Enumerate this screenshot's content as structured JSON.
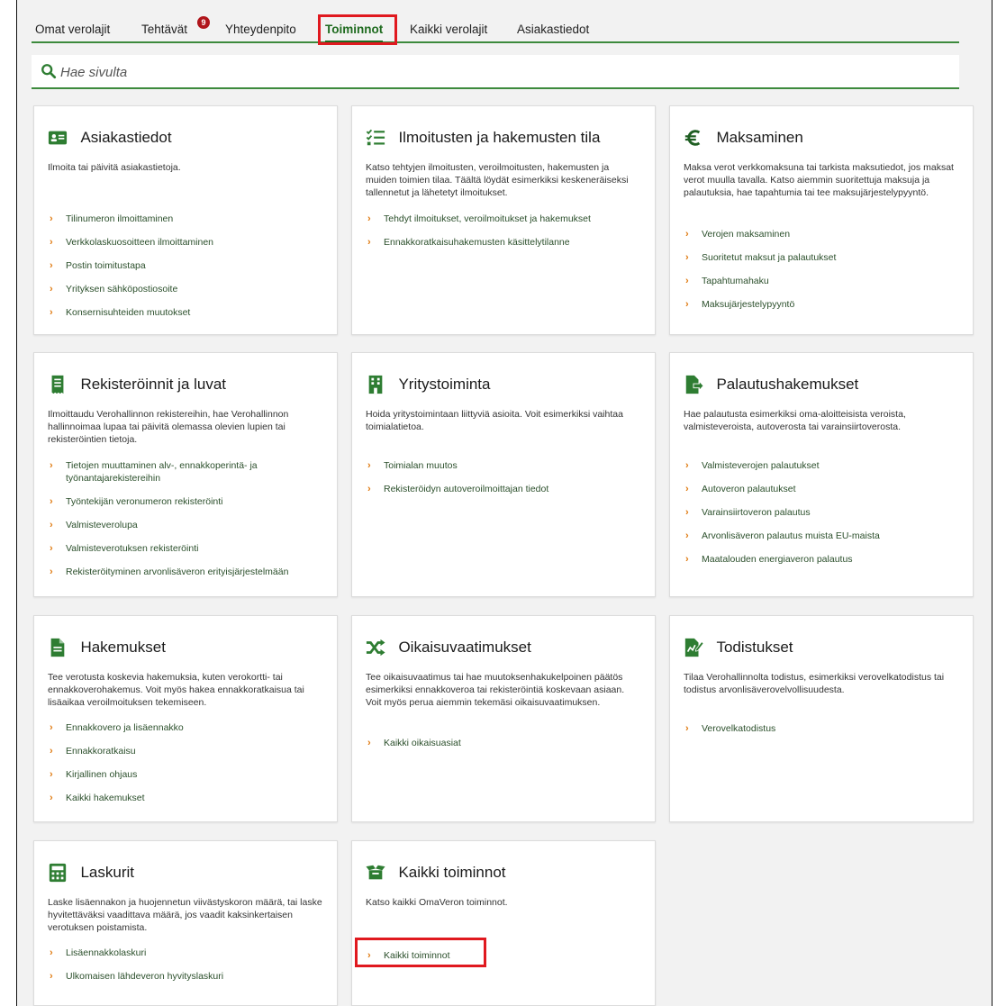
{
  "tabs": [
    {
      "label": "Omat verolajit"
    },
    {
      "label": "Tehtävät",
      "badge": "9"
    },
    {
      "label": "Yhteydenpito"
    },
    {
      "label": "Toiminnot",
      "active": true
    },
    {
      "label": "Kaikki verolajit"
    },
    {
      "label": "Asiakastiedot"
    }
  ],
  "search": {
    "placeholder": "Hae sivulta"
  },
  "colors": {
    "brand_green": "#2e7d32",
    "chevron": "#e07a10",
    "highlight": "#e0191f",
    "badge": "#b0151b"
  },
  "cards": [
    {
      "icon": "id-card-icon",
      "title": "Asiakastiedot",
      "description": "Ilmoita tai päivitä asiakastietoja.",
      "links": [
        "Tilinumeron ilmoittaminen",
        "Verkkolaskuosoitteen ilmoittaminen",
        "Postin toimitustapa",
        "Yrityksen sähköpostiosoite",
        "Konsernisuhteiden muutokset"
      ]
    },
    {
      "icon": "checklist-icon",
      "title": "Ilmoitusten ja hakemusten tila",
      "description": "Katso tehtyjen ilmoitusten, veroilmoitusten, hakemusten ja muiden toimien tilaa. Täältä löydät esimerkiksi keskeneräiseksi tallennetut ja lähetetyt ilmoitukset.",
      "links": [
        "Tehdyt ilmoitukset, veroilmoitukset ja hakemukset",
        "Ennakkoratkaisuhakemusten käsittelytilanne"
      ]
    },
    {
      "icon": "euro-icon",
      "title": "Maksaminen",
      "description": "Maksa verot verkkomaksuna tai tarkista maksutiedot, jos maksat verot muulla tavalla. Katso aiemmin suoritettuja maksuja ja palautuksia, hae tapahtumia tai tee maksujärjestelypyyntö.",
      "links": [
        "Verojen maksaminen",
        "Suoritetut maksut ja palautukset",
        "Tapahtumahaku",
        "Maksujärjestelypyyntö"
      ]
    },
    {
      "icon": "receipt-icon",
      "title": "Rekisteröinnit ja luvat",
      "description": "Ilmoittaudu Verohallinnon rekistereihin, hae Verohallinnon hallinnoimaa lupaa tai päivitä olemassa olevien lupien tai rekisteröintien tietoja.",
      "links": [
        "Tietojen muuttaminen alv-, ennakkoperintä- ja työnantajarekistereihin",
        "Työntekijän veronumeron rekisteröinti",
        "Valmisteverolupa",
        "Valmisteverotuksen rekisteröinti",
        "Rekisteröityminen arvonlisäveron erityisjärjestelmään"
      ]
    },
    {
      "icon": "building-icon",
      "title": "Yritystoiminta",
      "description": "Hoida yritystoimintaan liittyviä asioita. Voit esimerkiksi vaihtaa toimialatietoa.",
      "links": [
        "Toimialan muutos",
        "Rekisteröidyn autoveroilmoittajan tiedot"
      ]
    },
    {
      "icon": "file-return-icon",
      "title": "Palautushakemukset",
      "description": "Hae palautusta esimerkiksi oma-aloitteisista veroista, valmisteveroista, autoverosta tai varainsiirtoverosta.",
      "links": [
        "Valmisteverojen palautukset",
        "Autoveron palautukset",
        "Varainsiirtoveron palautus",
        "Arvonlisäveron palautus muista EU-maista",
        "Maatalouden energiaveron palautus"
      ]
    },
    {
      "icon": "document-icon",
      "title": "Hakemukset",
      "description": "Tee verotusta koskevia hakemuksia, kuten verokortti- tai ennakkoverohakemus. Voit myös hakea ennakkoratkaisua tai lisäaikaa veroilmoituksen tekemiseen.",
      "links": [
        "Ennakkovero ja lisäennakko",
        "Ennakkoratkaisu",
        "Kirjallinen ohjaus",
        "Kaikki hakemukset"
      ]
    },
    {
      "icon": "shuffle-icon",
      "title": "Oikaisuvaatimukset",
      "description": "Tee oikaisuvaatimus tai hae muutoksenhakukelpoinen päätös esimerkiksi ennakkoveroa tai rekisteröintiä koskevaan asiaan. Voit myös perua aiemmin tekemäsi oikaisuvaatimuksen.",
      "links": [
        "Kaikki oikaisuasiat"
      ]
    },
    {
      "icon": "certificate-icon",
      "title": "Todistukset",
      "description": "Tilaa Verohallinnolta todistus, esimerkiksi verovelkatodistus tai todistus arvonlisäverovelvollisuudesta.",
      "links": [
        "Verovelkatodistus"
      ]
    },
    {
      "icon": "calculator-icon",
      "title": "Laskurit",
      "description": "Laske lisäennakon ja huojennetun viivästyskoron määrä, tai laske hyvitettäväksi vaadittava määrä, jos vaadit kaksinkertaisen verotuksen poistamista.",
      "links": [
        "Lisäennakkolaskuri",
        "Ulkomaisen lähdeveron hyvityslaskuri"
      ]
    },
    {
      "icon": "open-box-icon",
      "title": "Kaikki toiminnot",
      "description": "Katso kaikki OmaVeron toiminnot.",
      "links": [
        "Kaikki toiminnot"
      ]
    }
  ]
}
